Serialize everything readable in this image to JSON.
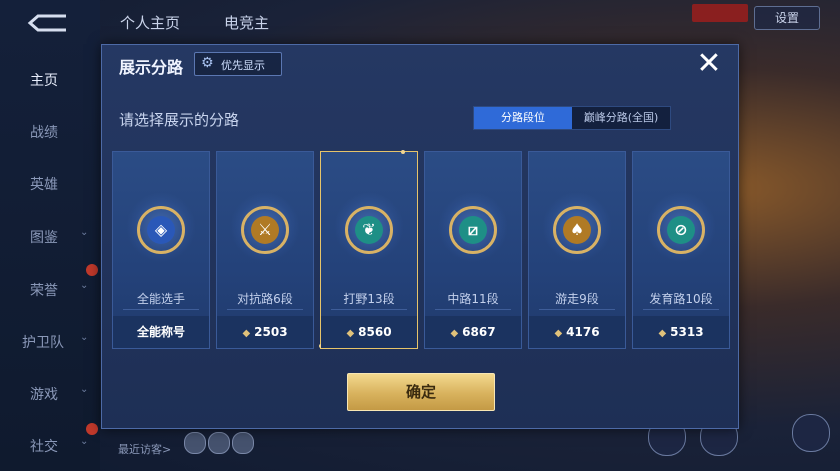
{
  "nav": {
    "items": [
      {
        "label": "主页"
      },
      {
        "label": "战绩"
      },
      {
        "label": "英雄"
      },
      {
        "label": "图鉴"
      },
      {
        "label": "荣誉"
      },
      {
        "label": "护卫队"
      },
      {
        "label": "游戏"
      },
      {
        "label": "社交"
      }
    ]
  },
  "topbar": {
    "tab1": "个人主页",
    "tab2": "电竞主",
    "settings": "设置"
  },
  "bottom": {
    "recent": "最近访客>"
  },
  "dialog": {
    "title": "展示分路",
    "priority_label": "优先显示",
    "subtitle": "请选择展示的分路",
    "segments": [
      "分路段位",
      "巅峰分路(全国)"
    ],
    "confirm": "确定",
    "cards": [
      {
        "name": "全能选手",
        "foot": "全能称号",
        "icon": "all-round-emblem-icon",
        "color": "#2a58b8"
      },
      {
        "name": "对抗路6段",
        "foot": "2503",
        "icon": "clash-lane-emblem-icon",
        "color": "#b07a25"
      },
      {
        "name": "打野13段",
        "foot": "8560",
        "icon": "jungle-emblem-icon",
        "color": "#1e8f86"
      },
      {
        "name": "中路11段",
        "foot": "6867",
        "icon": "mid-lane-emblem-icon",
        "color": "#1e8f86"
      },
      {
        "name": "游走9段",
        "foot": "4176",
        "icon": "roam-emblem-icon",
        "color": "#b07a25"
      },
      {
        "name": "发育路10段",
        "foot": "5313",
        "icon": "farm-lane-emblem-icon",
        "color": "#1e8f86"
      }
    ]
  }
}
